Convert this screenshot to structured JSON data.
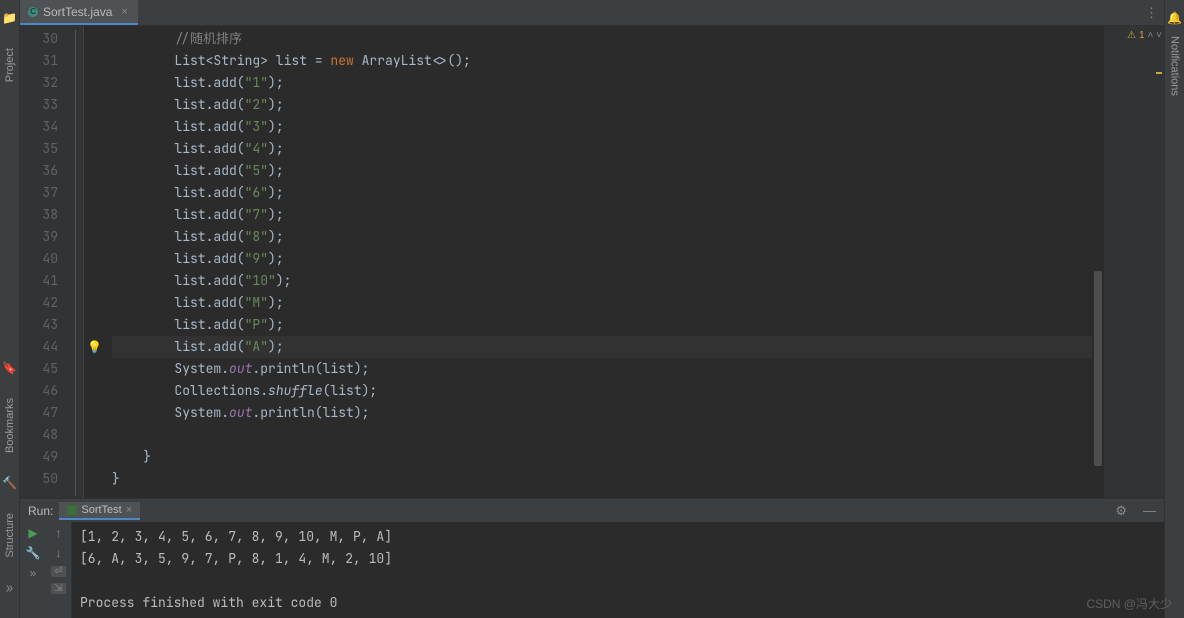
{
  "tabs": {
    "file": "SortTest.java"
  },
  "left_strip": {
    "project": "Project",
    "bookmarks": "Bookmarks",
    "structure": "Structure"
  },
  "right_strip": {
    "notifications": "Notifications"
  },
  "warnings": {
    "count": "1"
  },
  "gutter_start": 30,
  "bulb_line": 44,
  "current_line": 44,
  "code_lines": [
    {
      "n": 30,
      "seg": [
        [
          "c",
          "//随机排序"
        ]
      ]
    },
    {
      "n": 31,
      "seg": [
        [
          "t",
          "List<String> list = "
        ],
        [
          "k",
          "new "
        ],
        [
          "t",
          "ArrayList<>();"
        ]
      ]
    },
    {
      "n": 32,
      "seg": [
        [
          "t",
          "list.add("
        ],
        [
          "s",
          "\"1\""
        ],
        [
          "t",
          ");"
        ]
      ]
    },
    {
      "n": 33,
      "seg": [
        [
          "t",
          "list.add("
        ],
        [
          "s",
          "\"2\""
        ],
        [
          "t",
          ");"
        ]
      ]
    },
    {
      "n": 34,
      "seg": [
        [
          "t",
          "list.add("
        ],
        [
          "s",
          "\"3\""
        ],
        [
          "t",
          ");"
        ]
      ]
    },
    {
      "n": 35,
      "seg": [
        [
          "t",
          "list.add("
        ],
        [
          "s",
          "\"4\""
        ],
        [
          "t",
          ");"
        ]
      ]
    },
    {
      "n": 36,
      "seg": [
        [
          "t",
          "list.add("
        ],
        [
          "s",
          "\"5\""
        ],
        [
          "t",
          ");"
        ]
      ]
    },
    {
      "n": 37,
      "seg": [
        [
          "t",
          "list.add("
        ],
        [
          "s",
          "\"6\""
        ],
        [
          "t",
          ");"
        ]
      ]
    },
    {
      "n": 38,
      "seg": [
        [
          "t",
          "list.add("
        ],
        [
          "s",
          "\"7\""
        ],
        [
          "t",
          ");"
        ]
      ]
    },
    {
      "n": 39,
      "seg": [
        [
          "t",
          "list.add("
        ],
        [
          "s",
          "\"8\""
        ],
        [
          "t",
          ");"
        ]
      ]
    },
    {
      "n": 40,
      "seg": [
        [
          "t",
          "list.add("
        ],
        [
          "s",
          "\"9\""
        ],
        [
          "t",
          ");"
        ]
      ]
    },
    {
      "n": 41,
      "seg": [
        [
          "t",
          "list.add("
        ],
        [
          "s",
          "\"10\""
        ],
        [
          "t",
          ");"
        ]
      ]
    },
    {
      "n": 42,
      "seg": [
        [
          "t",
          "list.add("
        ],
        [
          "s",
          "\"M\""
        ],
        [
          "t",
          ");"
        ]
      ]
    },
    {
      "n": 43,
      "seg": [
        [
          "t",
          "list.add("
        ],
        [
          "s",
          "\"P\""
        ],
        [
          "t",
          ");"
        ]
      ]
    },
    {
      "n": 44,
      "seg": [
        [
          "t",
          "list.add("
        ],
        [
          "s",
          "\"A\""
        ],
        [
          "t",
          ");"
        ]
      ]
    },
    {
      "n": 45,
      "seg": [
        [
          "t",
          "System."
        ],
        [
          "f",
          "out"
        ],
        [
          "t",
          ".println(list);"
        ]
      ]
    },
    {
      "n": 46,
      "seg": [
        [
          "t",
          "Collections."
        ],
        [
          "m",
          "shuffle"
        ],
        [
          "t",
          "(list);"
        ]
      ]
    },
    {
      "n": 47,
      "seg": [
        [
          "t",
          "System."
        ],
        [
          "f",
          "out"
        ],
        [
          "t",
          ".println(list);"
        ]
      ]
    },
    {
      "n": 48,
      "seg": [
        [
          "t",
          ""
        ]
      ]
    },
    {
      "n": 49,
      "seg": [
        [
          "t",
          "}"
        ]
      ],
      "indent": 1
    },
    {
      "n": 50,
      "seg": [
        [
          "t",
          "}"
        ]
      ],
      "indent": 0
    }
  ],
  "run": {
    "label": "Run:",
    "config": "SortTest",
    "console": [
      "[1, 2, 3, 4, 5, 6, 7, 8, 9, 10, M, P, A]",
      "[6, A, 3, 5, 9, 7, P, 8, 1, 4, M, 2, 10]",
      "",
      "Process finished with exit code 0"
    ]
  },
  "watermark": "CSDN @冯大少"
}
